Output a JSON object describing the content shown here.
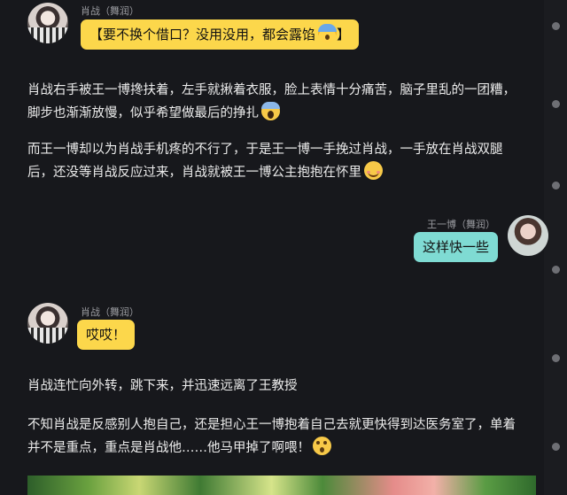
{
  "messages": [
    {
      "sender": "肖战（舞润）",
      "side": "left",
      "bubble_text": "【要不换个借口？没用没用，都会露馅",
      "bubble_emoji": "anxious-sweat-emoji",
      "bubble_suffix": "】"
    },
    {
      "sender": "王一博（舞润）",
      "side": "right",
      "bubble_text": "这样快一些"
    },
    {
      "sender": "肖战（舞润）",
      "side": "left",
      "bubble_text": "哎哎！"
    }
  ],
  "narration": {
    "p1": {
      "line1": "肖战右手被王一博搀扶着，左手就揪着衣服，脸上表情十分痛苦，脑子里乱的一团糟，",
      "line2": "脚步也渐渐放慢，似乎希望做最后的挣扎",
      "emoji": "screaming-face-emoji"
    },
    "p2": {
      "line1": "而王一博却以为肖战手机疼的不行了，于是王一博一手挽过肖战，一手放在肖战双腿",
      "line2": "后，还没等肖战反应过来，肖战就被王一博公主抱抱在怀里",
      "emoji": "smiling-blush-emoji"
    },
    "p3": {
      "line1": "肖战连忙向外转，跳下来，并迅速远离了王教授"
    },
    "p4": {
      "line1": "不知肖战是反感别人抱自己，还是担心王一博抱着自己去就更快得到达医务室了，单着",
      "line2": "并不是重点，重点是肖战他……他马甲掉了啊喂！",
      "emoji": "flushed-face-emoji"
    }
  },
  "colors": {
    "background": "#17181c",
    "bubble_yellow": "#fcd74b",
    "bubble_teal": "#7fdbd3"
  }
}
